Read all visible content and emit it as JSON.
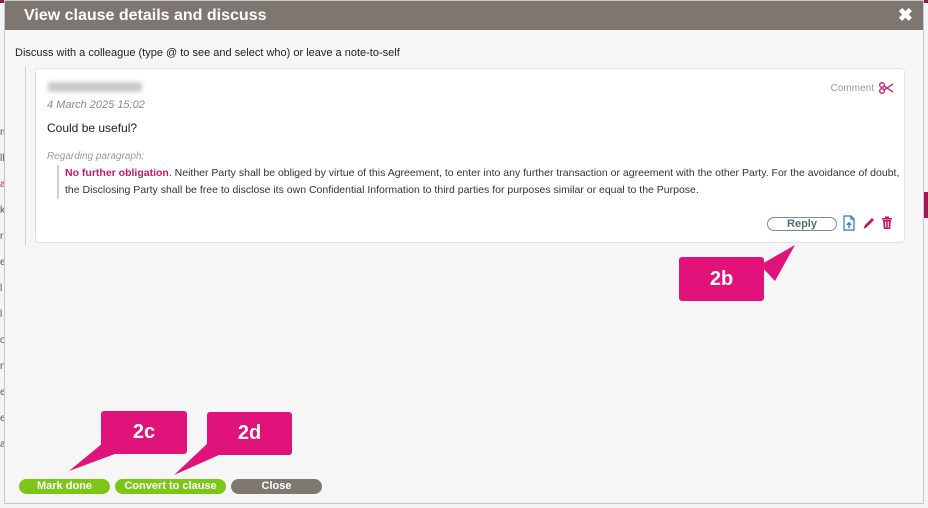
{
  "dialog": {
    "title": "View clause details and discuss",
    "close_glyph": "✖",
    "instruction": "Discuss with a colleague (type @ to see and select who) or leave a note-to-self"
  },
  "comment": {
    "timestamp": "4 March 2025 15:02",
    "type_label": "Comment",
    "body": "Could be useful?",
    "regarding_label": "Regarding paragraph:",
    "paragraph_title": "No further obligation",
    "paragraph_text": ". Neither Party shall be obliged by virtue of this Agreement, to enter into any further transaction or agreement with the other Party. For the avoidance of doubt, the Disclosing Party shall be free to disclose its own Confidential Information to third parties for purposes similar or equal to the Purpose.",
    "reply_label": "Reply"
  },
  "callouts": {
    "b": "2b",
    "c": "2c",
    "d": "2d"
  },
  "footer": {
    "mark_done": "Mark done",
    "convert": "Convert to clause",
    "close": "Close"
  },
  "background": {
    "letters": [
      "m",
      "ll",
      "a",
      "k",
      "r",
      "e",
      "l",
      "l",
      "o",
      "n",
      "e",
      "e",
      "a"
    ]
  },
  "colors": {
    "title_bar": "#7e7670",
    "accent": "#e0137b",
    "green": "#7cc618",
    "grey": "#7f7871"
  }
}
